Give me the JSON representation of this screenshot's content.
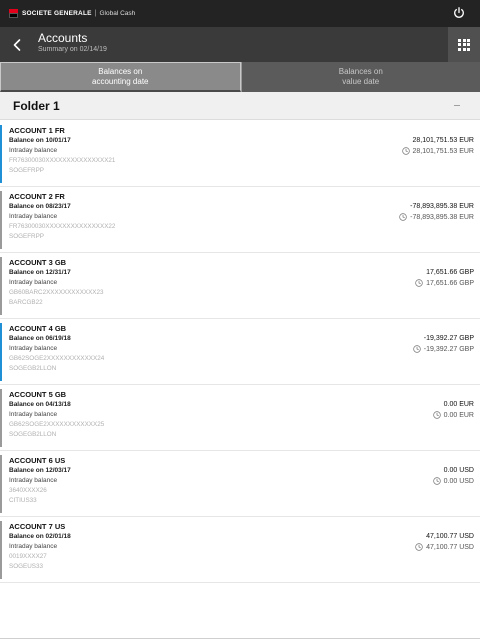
{
  "topbar": {
    "brand_name": "SOCIETE GENERALE",
    "separator": "|",
    "product": "Global Cash",
    "brand_color": "#e2001a",
    "power_icon": "power-icon"
  },
  "navbar": {
    "title": "Accounts",
    "subtitle": "Summary on 02/14/19",
    "back_icon": "chevron-left-icon",
    "menu_icon": "grid-icon"
  },
  "tabs": [
    {
      "line1": "Balances on",
      "line2": "accounting date",
      "active": true
    },
    {
      "line1": "Balances on",
      "line2": "value date",
      "active": false
    }
  ],
  "folder": {
    "title": "Folder 1",
    "collapse_icon": "minus-icon"
  },
  "accounts": [
    {
      "name": "ACCOUNT 1 FR",
      "date_label": "Balance on 10/01/17",
      "intraday_label": "Intraday balance",
      "iban": "FR76300030XXXXXXXXXXXXXXX21",
      "bic": "SOGEFRPP",
      "balance": "28,101,751.53 EUR",
      "intraday_balance": "28,101,751.53 EUR",
      "accent": "blue"
    },
    {
      "name": "ACCOUNT 2 FR",
      "date_label": "Balance on 08/23/17",
      "intraday_label": "Intraday balance",
      "iban": "FR76300030XXXXXXXXXXXXXXX22",
      "bic": "SOGEFRPP",
      "balance": "-78,893,895.38 EUR",
      "intraday_balance": "-78,893,895.38 EUR",
      "accent": "grey"
    },
    {
      "name": "ACCOUNT 3 GB",
      "date_label": "Balance on 12/31/17",
      "intraday_label": "Intraday balance",
      "iban": "GB60BARC2XXXXXXXXXXXX23",
      "bic": "BARCGB22",
      "balance": "17,651.66 GBP",
      "intraday_balance": "17,651.66 GBP",
      "accent": "grey"
    },
    {
      "name": "ACCOUNT 4 GB",
      "date_label": "Balance on 06/19/18",
      "intraday_label": "Intraday balance",
      "iban": "GB62SOGE2XXXXXXXXXXXX24",
      "bic": "SOGEGB2LLON",
      "balance": "-19,392.27 GBP",
      "intraday_balance": "-19,392.27 GBP",
      "accent": "blue"
    },
    {
      "name": "ACCOUNT 5 GB",
      "date_label": "Balance on 04/13/18",
      "intraday_label": "Intraday balance",
      "iban": "GB62SOGE2XXXXXXXXXXXX25",
      "bic": "SOGEGB2LLON",
      "balance": "0.00 EUR",
      "intraday_balance": "0.00 EUR",
      "accent": "grey"
    },
    {
      "name": "ACCOUNT 6 US",
      "date_label": "Balance on 12/03/17",
      "intraday_label": "Intraday balance",
      "iban": "3640XXXX26",
      "bic": "CITIUS33",
      "balance": "0.00 USD",
      "intraday_balance": "0.00 USD",
      "accent": "grey"
    },
    {
      "name": "ACCOUNT 7 US",
      "date_label": "Balance on 02/01/18",
      "intraday_label": "Intraday balance",
      "iban": "0019XXXX27",
      "bic": "SOGEUS33",
      "balance": "47,100.77 USD",
      "intraday_balance": "47,100.77 USD",
      "accent": "grey"
    }
  ]
}
